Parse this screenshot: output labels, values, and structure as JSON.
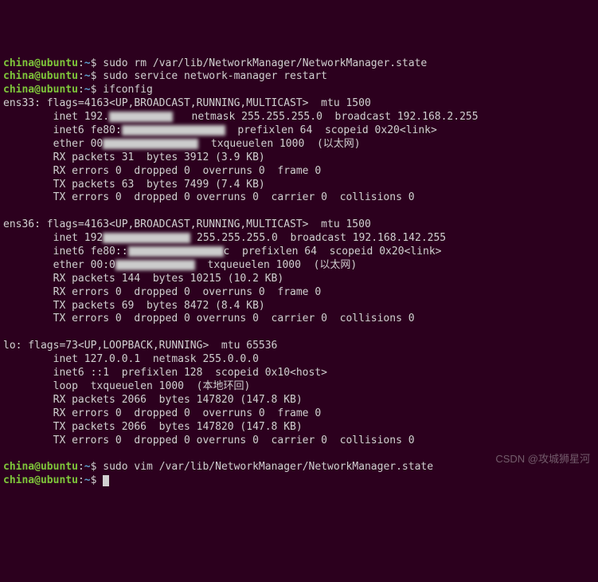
{
  "prompt": {
    "user": "china",
    "host": "ubuntu",
    "pathsym": "~",
    "sep": "$"
  },
  "cmds": {
    "c1": "sudo rm /var/lib/NetworkManager/NetworkManager.state",
    "c2": "sudo service network-manager restart",
    "c3": "ifconfig",
    "c4": "sudo vim /var/lib/NetworkManager/NetworkManager.state",
    "c5": ""
  },
  "ens33": {
    "hdr": "ens33: flags=4163<UP,BROADCAST,RUNNING,MULTICAST>  mtu 1500",
    "inet_a": "        inet 192.",
    "inet_b": "   netmask 255.255.255.0  broadcast 192.168.2.255",
    "inet6_a": "        inet6 fe80:",
    "inet6_b": "  prefixlen 64  scopeid 0x20<link>",
    "eth_a": "        ether 00",
    "eth_b": "  txqueuelen 1000  (以太网)",
    "rxp": "        RX packets 31  bytes 3912 (3.9 KB)",
    "rxe": "        RX errors 0  dropped 0  overruns 0  frame 0",
    "txp": "        TX packets 63  bytes 7499 (7.4 KB)",
    "txe": "        TX errors 0  dropped 0 overruns 0  carrier 0  collisions 0"
  },
  "ens36": {
    "hdr": "ens36: flags=4163<UP,BROADCAST,RUNNING,MULTICAST>  mtu 1500",
    "inet_a": "        inet 192",
    "inet_b": " 255.255.255.0  broadcast 192.168.142.255",
    "inet6_a": "        inet6 fe80::",
    "inet6_b": "c  prefixlen 64  scopeid 0x20<link>",
    "eth_a": "        ether 00:0",
    "eth_b": "  txqueuelen 1000  (以太网)",
    "rxp": "        RX packets 144  bytes 10215 (10.2 KB)",
    "rxe": "        RX errors 0  dropped 0  overruns 0  frame 0",
    "txp": "        TX packets 69  bytes 8472 (8.4 KB)",
    "txe": "        TX errors 0  dropped 0 overruns 0  carrier 0  collisions 0"
  },
  "lo": {
    "hdr": "lo: flags=73<UP,LOOPBACK,RUNNING>  mtu 65536",
    "inet": "        inet 127.0.0.1  netmask 255.0.0.0",
    "inet6": "        inet6 ::1  prefixlen 128  scopeid 0x10<host>",
    "loop": "        loop  txqueuelen 1000  (本地环回)",
    "rxp": "        RX packets 2066  bytes 147820 (147.8 KB)",
    "rxe": "        RX errors 0  dropped 0  overruns 0  frame 0",
    "txp": "        TX packets 2066  bytes 147820 (147.8 KB)",
    "txe": "        TX errors 0  dropped 0 overruns 0  carrier 0  collisions 0"
  },
  "watermark": "CSDN @攻城狮星河"
}
